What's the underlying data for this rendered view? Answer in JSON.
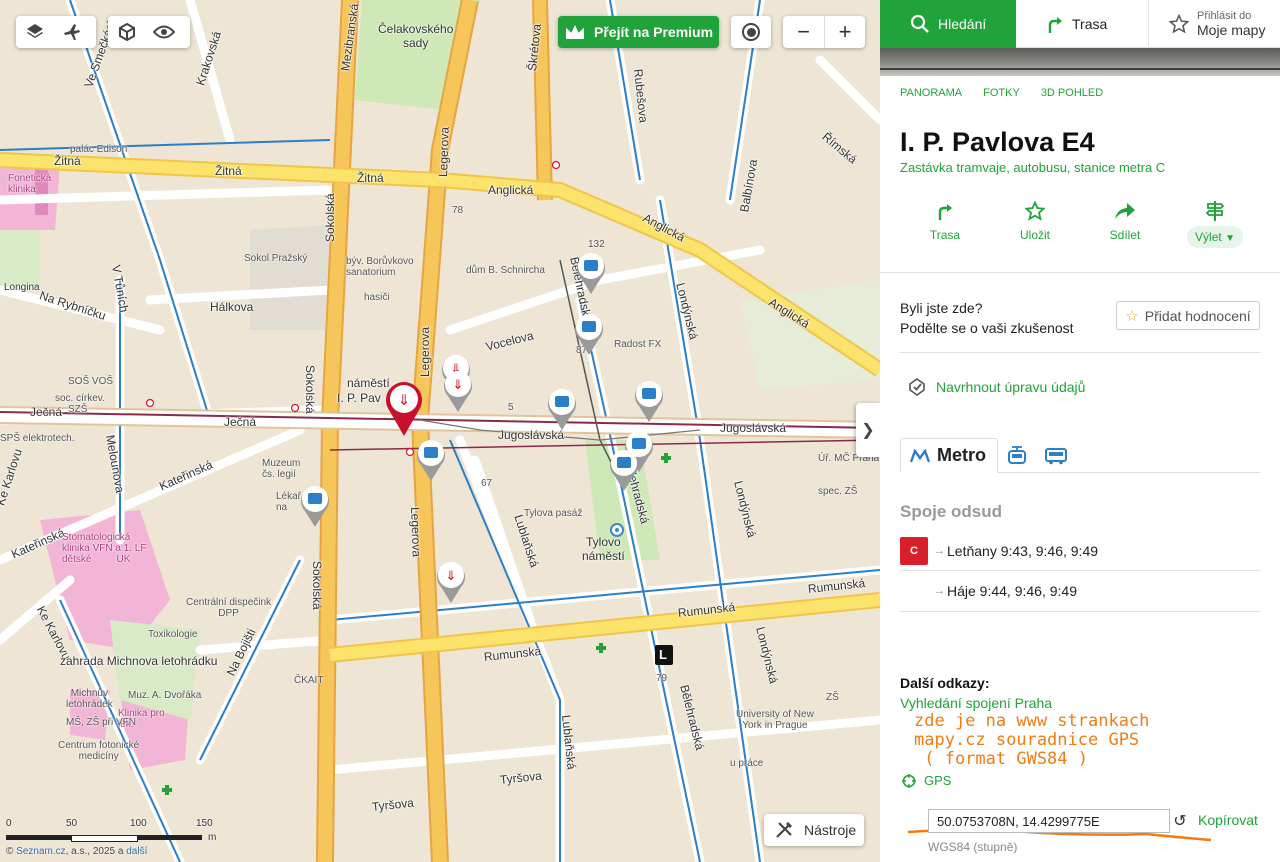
{
  "map": {
    "controls": {
      "layers_icon": "layers-icon",
      "aerial_icon": "airplane-icon",
      "three_d_icon": "cube-icon",
      "view_icon": "eye-icon",
      "premium_label": "Přejít na Premium",
      "zoom_out": "−",
      "zoom_in": "+"
    },
    "streets": {
      "zitna_1": "Žitná",
      "zitna_2": "Žitná",
      "zitna_3": "Žitná",
      "anglicka_1": "Anglická",
      "anglicka_2": "Anglická",
      "anglicka_3": "Anglická",
      "jecna_1": "Ječná",
      "jecna_2": "Ječná",
      "jugoslavska_1": "Jugoslávská",
      "jugoslavska_2": "Jugoslávská",
      "legerova_1": "Legerova",
      "legerova_2": "Legerova",
      "legerova_3": "Legerova",
      "sokolska_1": "Sokolská",
      "sokolska_2": "Sokolská",
      "sokolska_3": "Sokolská",
      "rumunska_1": "Rumunská",
      "rumunska_2": "Rumunská",
      "rumunska_3": "Rumunská",
      "tyrsova_1": "Tyršova",
      "tyrsova_2": "Tyršova",
      "vocelova": "Vocelova",
      "halkova": "Hálkova",
      "na_rybnicku": "Na Rybníčku",
      "katerinska_1": "Kateřinská",
      "katerinska_2": "Kateřinská",
      "melounova": "Melounova",
      "lublanska_1": "Lublaňská",
      "lublanska_2": "Lublaňská",
      "belehradska_1": "Bělehradská",
      "belehradska_2": "Bělehradská",
      "londynska_1": "Londýnská",
      "londynska_2": "Londýnská",
      "londynska_3": "Londýnská",
      "belehradska_top": "Bělehradská",
      "balbinova": "Balbínova",
      "rimska": "Římská",
      "rubesova": "Rubešova",
      "skretova": "Škrétova",
      "mezibranska": "Mezibranská",
      "krakovska": "Krakovská",
      "ve_smeckach": "Ve Smečkách",
      "v_tunich": "V Tůních",
      "na_bojisti": "Na Bojišti",
      "ke_karlovu": "Ke Karlovu",
      "ke_karlovu_2": "Ke Karlovu",
      "longina": "Longina"
    },
    "pois": {
      "celakovskeho_sady": "Čelakovského\nsady",
      "palac_edison": "palác Edison",
      "fonetika": "Fonetická\nklinika",
      "sokol_prazsky": "Sokol Pražský",
      "borukovo": "býv. Borůvkovo\nsanatorium",
      "hasici": "hasiči",
      "schnirch": "dům B. Schnircha",
      "radost_fx": "Radost FX",
      "sos_vos": "SOŠ VOŠ",
      "soc_cirkev": "soc. církev.",
      "szs": "SZŠ",
      "sps_elektro": "SPŠ elektrotech.",
      "namesti": "náměstí",
      "ip_pavlova": "I. P. Pav",
      "muzeum": "Muzeum\nčs. legií",
      "lekarna": "Lékař\nna",
      "stomatologicka": "Stomatologická\nklinika VFN a 1. LF\ndětské         UK",
      "centralni_dispecink": "Centrální dispečink\nDPP",
      "toxikologie": "Toxikologie",
      "zahrada": "zahrada Michnova letohrádku",
      "michnuv": "Michnův\nletohrádek",
      "muz_dvoraka": "Muz. A. Dvořáka",
      "klinika_pro": "Klinika pro\nlék.",
      "ms_zs": "MŠ, ZŠ při VFN",
      "centrum_foto": "Centrum fotonické\nmedicíny",
      "ckait": "ČKAIT",
      "tylova_pasaz": "Tylova pasáž",
      "tylovo_namesti": "Tylovo\nnáměstí",
      "ur_mc": "Úř. MČ Praha",
      "spec_zs": "spec. ZŠ",
      "zs": "ZŠ",
      "university": "University of New\nYork in Prague",
      "u_prace": "u práce",
      "num_78": "78",
      "num_132": "132",
      "num_87": "87",
      "num_67": "67",
      "num_79": "79",
      "num_5": "5"
    },
    "scale": {
      "t0": "0",
      "t50": "50",
      "t100": "100",
      "t150": "150",
      "unit": "m"
    },
    "copyright": {
      "prefix": "© ",
      "seznam": "Seznam.cz",
      "rest": ", a.s., 2025 a ",
      "dalsi": "další"
    },
    "tools_label": "Nástroje",
    "metro_letter": "L"
  },
  "panel": {
    "tabs": {
      "search": "Hledání",
      "route": "Trasa",
      "login_small": "Přihlásit do",
      "my_maps": "Moje mapy"
    },
    "media_links": [
      "PANORAMA",
      "FOTKY",
      "3D POHLED"
    ],
    "title": "I. P. Pavlova E4",
    "subtitle": "Zastávka tramvaje, autobusu, stanice metra C",
    "actions": {
      "route": "Trasa",
      "save": "Uložit",
      "share": "Sdílet",
      "trip": "Výlet"
    },
    "visited": {
      "line1": "Byli jste zde?",
      "line2": "Podělte se o vaši zkušenost",
      "button": "Přidat hodnocení"
    },
    "suggest_edit": "Navrhnout úpravu údajů",
    "transit_tabs": {
      "metro": "Metro"
    },
    "departures": {
      "title": "Spoje odsud",
      "line": "C",
      "rows": [
        {
          "text": "Letňany 9:43, 9:46, 9:49"
        },
        {
          "text": "Háje 9:44, 9:46, 9:49"
        }
      ]
    },
    "more_links": {
      "title": "Další odkazy:",
      "link": "Vyhledání spojení Praha"
    },
    "annotation": "zde je na www strankach\nmapy.cz souradnice GPS\n ( format GWS84 )",
    "gps": {
      "label": "GPS",
      "value": "50.0753708N, 14.4299775E",
      "copy": "Kopírovat",
      "format": "WGS84 (stupně)"
    }
  },
  "colors": {
    "accent": "#1fa33a",
    "metro_c": "#d8202a",
    "annotation": "#f07c12"
  }
}
